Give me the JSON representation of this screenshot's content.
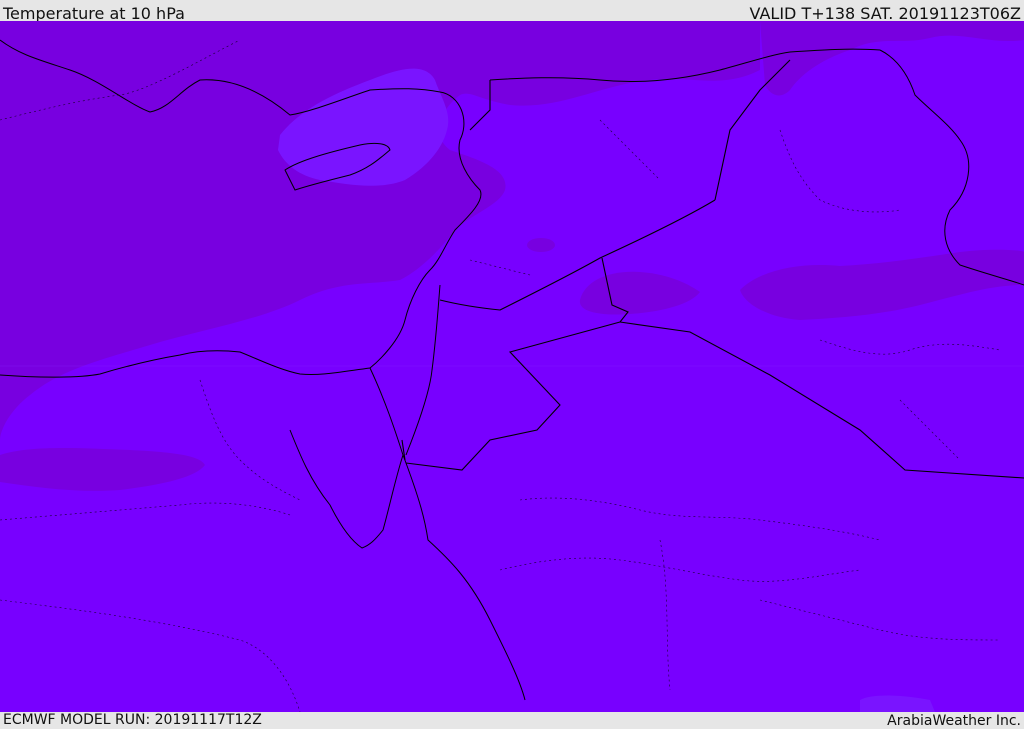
{
  "header": {
    "title": "Temperature at 10 hPa",
    "valid": "VALID T+138 SAT. 20191123T06Z"
  },
  "footer": {
    "model_run": "ECMWF MODEL RUN: 20191117T12Z",
    "credit": "ArabiaWeather Inc."
  },
  "map": {
    "colors": {
      "warm_band": "#7800e0",
      "cool_field": "#7800ff",
      "light_field": "#7a14ff",
      "border": "#000000"
    }
  }
}
